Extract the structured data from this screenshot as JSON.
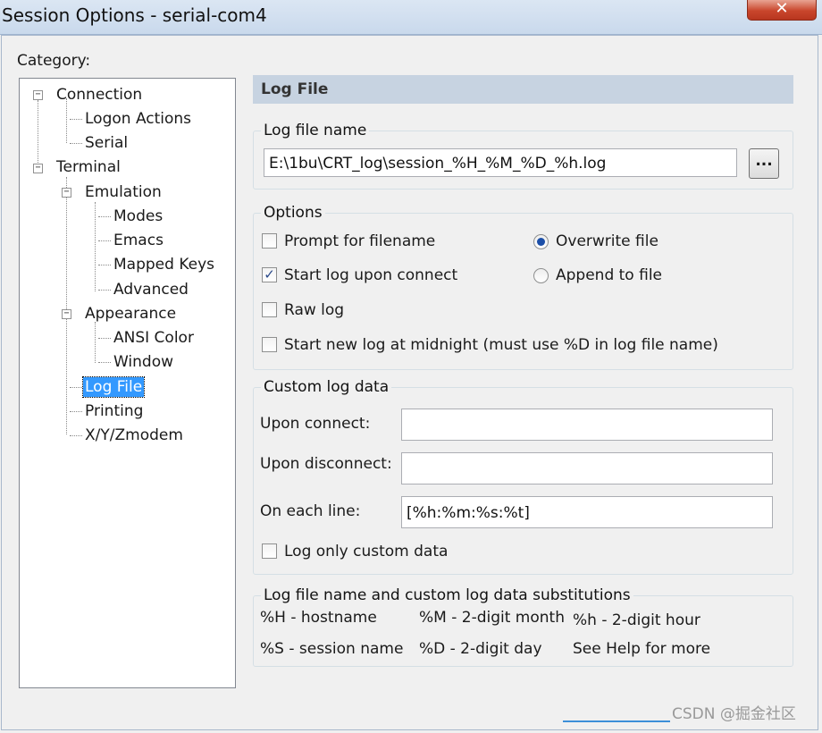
{
  "window": {
    "title": "Session Options - serial-com4",
    "close_glyph": "✕"
  },
  "category": {
    "label": "Category:",
    "tree": {
      "connection": "Connection",
      "logon_actions": "Logon Actions",
      "serial": "Serial",
      "terminal": "Terminal",
      "emulation": "Emulation",
      "modes": "Modes",
      "emacs": "Emacs",
      "mapped_keys": "Mapped Keys",
      "advanced": "Advanced",
      "appearance": "Appearance",
      "ansi_color": "ANSI Color",
      "window": "Window",
      "log_file": "Log File",
      "printing": "Printing",
      "xyzmodem": "X/Y/Zmodem",
      "collapse_glyph": "−"
    }
  },
  "panel": {
    "header": "Log File",
    "log_file_name": {
      "legend": "Log file name",
      "value": "E:\\1bu\\CRT_log\\session_%H_%M_%D_%h.log",
      "browse_label": "..."
    },
    "options": {
      "legend": "Options",
      "prompt_for_filename": {
        "label": "Prompt for filename",
        "checked": false
      },
      "start_log_upon_connect": {
        "label": "Start log upon connect",
        "checked": true,
        "mark": "✓"
      },
      "raw_log": {
        "label": "Raw log",
        "checked": false
      },
      "start_new_log_midnight": {
        "label": "Start new log at midnight (must use %D in log file name)",
        "checked": false
      },
      "overwrite_file": {
        "label": "Overwrite file",
        "selected": true
      },
      "append_to_file": {
        "label": "Append to file",
        "selected": false
      }
    },
    "custom_log_data": {
      "legend": "Custom log data",
      "upon_connect_label": "Upon connect:",
      "upon_connect_value": "",
      "upon_disconnect_label": "Upon disconnect:",
      "upon_disconnect_value": "",
      "on_each_line_label": "On each line:",
      "on_each_line_value": "[%h:%m:%s:%t]",
      "log_only_custom": {
        "label": "Log only custom data",
        "checked": false
      }
    },
    "substitutions": {
      "legend": "Log file name and custom log data substitutions",
      "items": [
        "%H - hostname",
        "%M - 2-digit month",
        "%h - 2-digit hour",
        "%S - session name",
        "%D - 2-digit day",
        "See Help for more"
      ]
    }
  },
  "watermark": "CSDN @掘金社区"
}
